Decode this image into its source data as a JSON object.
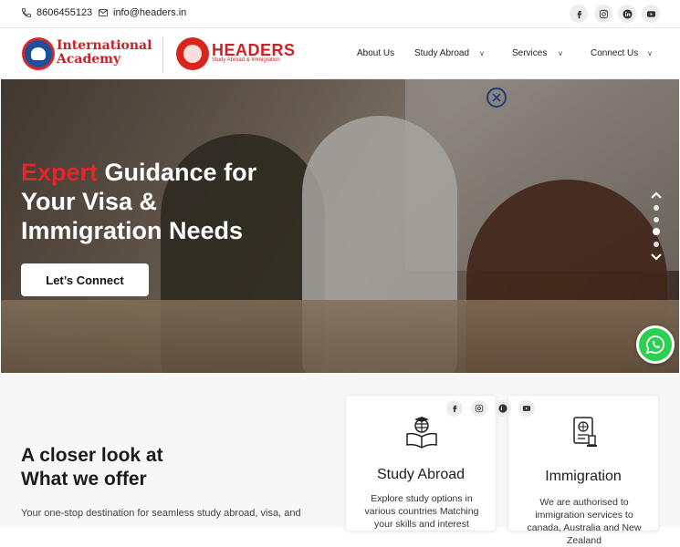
{
  "topbar": {
    "phone": "8606455123",
    "email": "info@headers.in",
    "social_icons": [
      "facebook-icon",
      "instagram-icon",
      "linkedin-icon",
      "youtube-icon"
    ]
  },
  "brand": {
    "academy_line1": "International",
    "academy_line2": "Academy",
    "headers_name": "HEADERS",
    "headers_tagline": "Study Abroad & Immigration"
  },
  "nav": {
    "items": [
      {
        "label": "About Us",
        "has_dropdown": false
      },
      {
        "label": "Study Abroad",
        "has_dropdown": true
      },
      {
        "label": "Services",
        "has_dropdown": true
      },
      {
        "label": "Connect Us",
        "has_dropdown": true
      }
    ],
    "chevron": "v"
  },
  "hero": {
    "title_accent": "Expert",
    "title_rest1": " Guidance for",
    "title_line2": "Your Visa &",
    "title_line3": "Immigration Needs",
    "cta_label": "Let’s Connect",
    "slide_count": 4,
    "active_slide": 3
  },
  "offer": {
    "title_line1": "A closer look at",
    "title_line2": "What we offer",
    "description": "Your one-stop destination for seamless study abroad, visa, and"
  },
  "cards": [
    {
      "title": "Study Abroad",
      "description": "Explore study options in various countries Matching your skills and interest",
      "icon": "graduation-book-icon"
    },
    {
      "title": "Immigration",
      "description": "We are authorised to immigration services to canada, Australia and New Zealand",
      "icon": "passport-icon"
    }
  ],
  "colors": {
    "accent_red": "#e3262c",
    "brand_blue": "#1d4f9a",
    "whatsapp_green": "#2ad04f"
  }
}
